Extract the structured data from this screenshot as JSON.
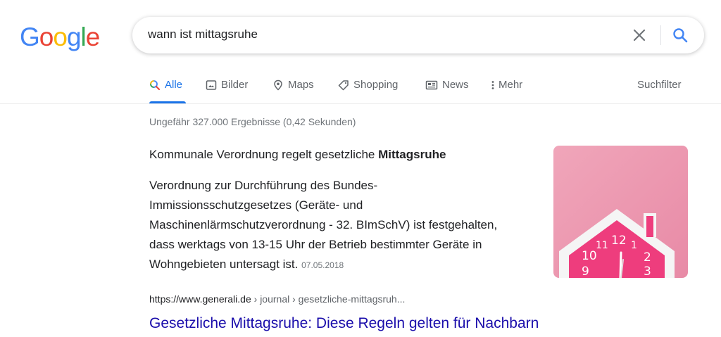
{
  "logo": {
    "letters": [
      "G",
      "o",
      "o",
      "g",
      "l",
      "e"
    ],
    "colors": [
      "#4285F4",
      "#EA4335",
      "#FBBC05",
      "#4285F4",
      "#34A853",
      "#EA4335"
    ]
  },
  "search": {
    "query": "wann ist mittagsruhe"
  },
  "tabs": [
    {
      "label": "Alle",
      "icon": "search-icon",
      "active": true
    },
    {
      "label": "Bilder",
      "icon": "image-icon"
    },
    {
      "label": "Maps",
      "icon": "map-pin-icon"
    },
    {
      "label": "Shopping",
      "icon": "tag-icon"
    },
    {
      "label": "News",
      "icon": "newspaper-icon"
    },
    {
      "label": "Mehr",
      "icon": "more-vert-icon"
    }
  ],
  "suchfilter": "Suchfilter",
  "stats": "Ungefähr 327.000 Ergebnisse (0,42 Sekunden)",
  "snippet": {
    "title_prefix": "Kommunale Verordnung regelt gesetzliche ",
    "title_bold": "Mittagsruhe",
    "body": "Verordnung zur Durchführung des Bundes-Immissionsschutzgesetzes (Geräte- und Maschinenlärmschutzverordnung - 32. BImSchV) ist festgehalten, dass werktags von 13-15 Uhr der Betrieb bestimmter Geräte in Wohngebieten untersagt ist.",
    "date": "07.05.2018"
  },
  "result": {
    "domain": "https://www.generali.de",
    "crumbs": " › journal › gesetzliche-mittagsruh...",
    "title": "Gesetzliche Mittagsruhe: Diese Regeln gelten für Nachbarn"
  },
  "colors": {
    "accent": "#1a73e8",
    "link": "#1a0dab"
  }
}
